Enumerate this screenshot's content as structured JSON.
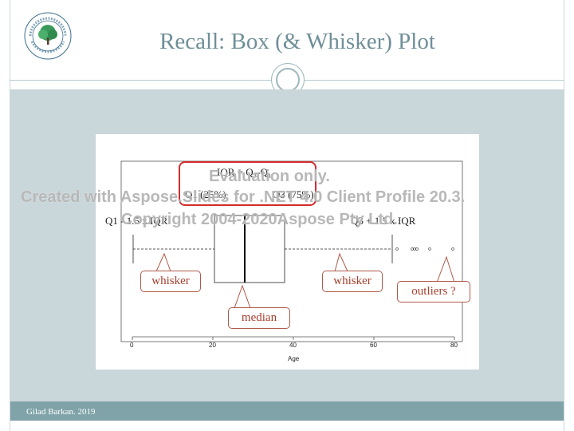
{
  "slide": {
    "title": "Recall: Box (& Whisker) Plot",
    "footer": "Gilad Barkan. 2019",
    "logo_label": "Ruppin Academic Center"
  },
  "plot": {
    "iqr_formula": "IQR = Q₃-Q₁",
    "q1_label": "Q1 (25%)",
    "q3_label": "Q3 (75%)",
    "lower_fence_label": "Q1 - 1.5 x IQR",
    "upper_fence_label": "Q3 + 1.5 x IQR",
    "x_axis_label": "Age",
    "x_ticks": [
      "0",
      "20",
      "40",
      "60",
      "80"
    ]
  },
  "callouts": {
    "whisker_left": "whisker",
    "whisker_right": "whisker",
    "median": "median",
    "outliers": "outliers ?"
  },
  "watermark": {
    "line1": "Evaluation only.",
    "line2": "Created with Aspose.Slides for .NET 4.0 Client Profile 20.3.",
    "line3": "Copyright 2004-2020Aspose Pty Ltd."
  },
  "colors": {
    "title": "#6f8f98",
    "content_bg": "#c9d6da",
    "footer_bg": "#7fa3a8",
    "callout_border": "#b05a4a",
    "callout_text": "#a6402e",
    "iqr_box": "#d42b2b"
  },
  "icons": {
    "logo": "tree-logo-icon",
    "ornament": "ring-ornament-icon"
  }
}
